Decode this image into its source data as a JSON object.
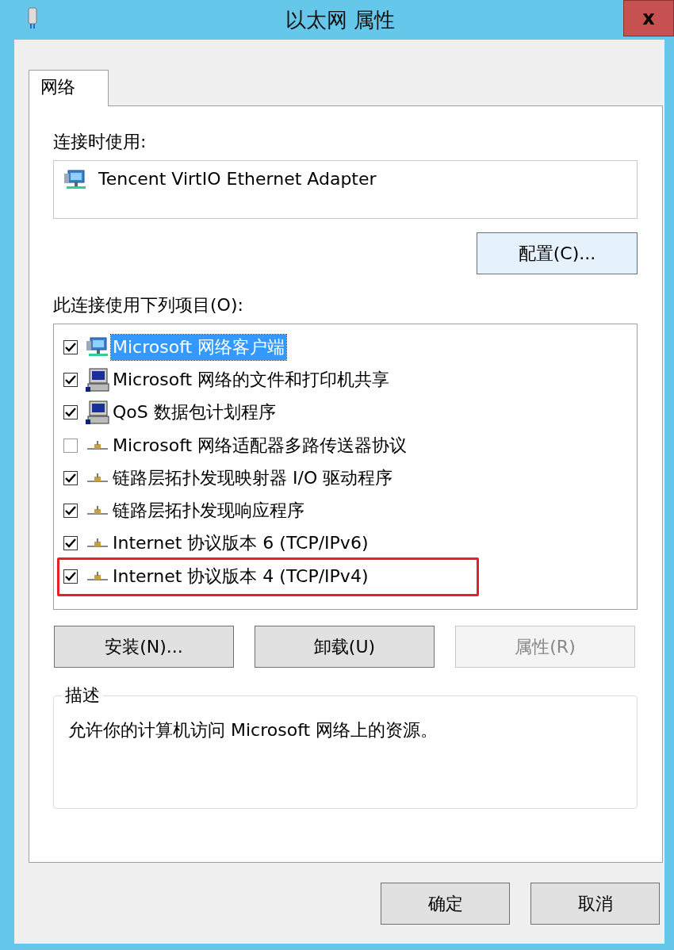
{
  "window": {
    "title": "以太网 属性",
    "close": "x"
  },
  "tabs": [
    {
      "label": "网络",
      "selected": true
    }
  ],
  "connect_using": {
    "label": "连接时使用:",
    "adapter": "Tencent VirtIO Ethernet Adapter",
    "configure_button": "配置(C)..."
  },
  "items_label": "此连接使用下列项目(O):",
  "items": [
    {
      "kind": "client",
      "label": "Microsoft 网络客户端",
      "checked": true,
      "selected": true,
      "marked": false
    },
    {
      "kind": "service",
      "label": "Microsoft 网络的文件和打印机共享",
      "checked": true,
      "selected": false,
      "marked": false
    },
    {
      "kind": "service",
      "label": "QoS 数据包计划程序",
      "checked": true,
      "selected": false,
      "marked": false
    },
    {
      "kind": "protocol",
      "label": "Microsoft 网络适配器多路传送器协议",
      "checked": false,
      "selected": false,
      "marked": false
    },
    {
      "kind": "protocol",
      "label": "链路层拓扑发现映射器 I/O 驱动程序",
      "checked": true,
      "selected": false,
      "marked": false
    },
    {
      "kind": "protocol",
      "label": "链路层拓扑发现响应程序",
      "checked": true,
      "selected": false,
      "marked": false
    },
    {
      "kind": "protocol",
      "label": "Internet 协议版本 6 (TCP/IPv6)",
      "checked": true,
      "selected": false,
      "marked": false
    },
    {
      "kind": "protocol",
      "label": "Internet 协议版本 4 (TCP/IPv4)",
      "checked": true,
      "selected": false,
      "marked": true
    }
  ],
  "item_buttons": [
    {
      "label": "安装(N)...",
      "disabled": false
    },
    {
      "label": "卸载(U)",
      "disabled": false
    },
    {
      "label": "属性(R)",
      "disabled": true
    }
  ],
  "description": {
    "title": "描述",
    "text": "允许你的计算机访问 Microsoft 网络上的资源。"
  },
  "buttons": [
    "确定",
    "取消"
  ]
}
